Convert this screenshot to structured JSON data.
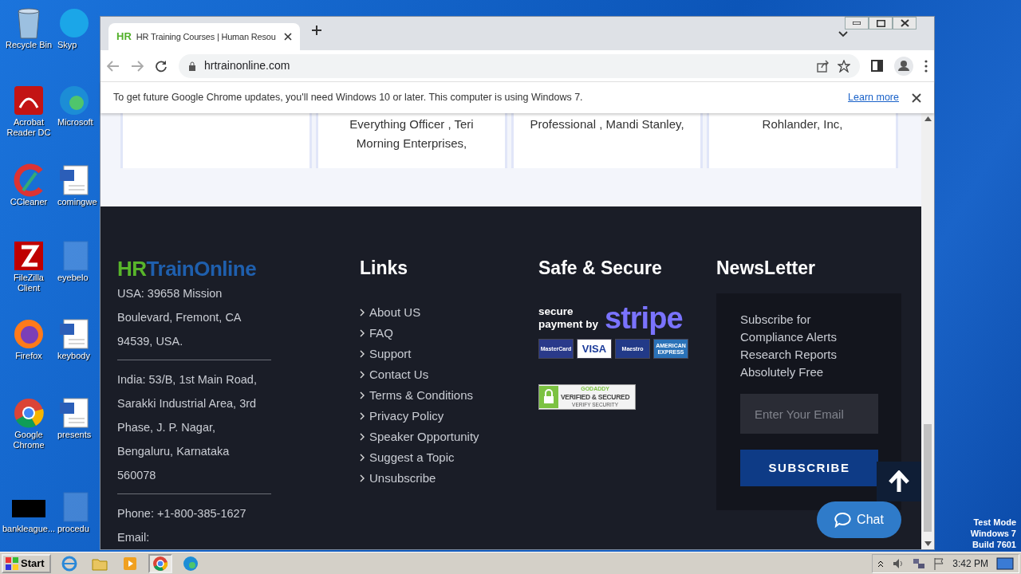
{
  "desktop": {
    "icons": [
      {
        "label": "Recycle Bin",
        "kind": "trash"
      },
      {
        "label": "Skyp",
        "kind": "skype"
      },
      {
        "label": "Acrobat Reader DC",
        "kind": "acrobat"
      },
      {
        "label": "Microsoft",
        "kind": "edge"
      },
      {
        "label": "CCleaner",
        "kind": "ccleaner"
      },
      {
        "label": "comingwe",
        "kind": "word"
      },
      {
        "label": "FileZilla Client",
        "kind": "filezilla"
      },
      {
        "label": "eyebelo",
        "kind": "word-blank"
      },
      {
        "label": "Firefox",
        "kind": "firefox"
      },
      {
        "label": "keybody",
        "kind": "word"
      },
      {
        "label": "Google Chrome",
        "kind": "chrome"
      },
      {
        "label": "presents",
        "kind": "word"
      },
      {
        "label": "bankleague...",
        "kind": "black"
      },
      {
        "label": "procedu",
        "kind": "word-blank"
      }
    ],
    "os_info": [
      "Test Mode",
      "Windows 7",
      "Build 7601"
    ]
  },
  "browser": {
    "tab": {
      "favicon": "HR",
      "title": "HR Training Courses | Human Resou"
    },
    "url": "hrtrainonline.com",
    "infobar": {
      "message": "To get future Google Chrome updates, you'll need Windows 10 or later. This computer is using Windows 7.",
      "link": "Learn more"
    }
  },
  "page": {
    "testimonial_cards": [
      {
        "kind": "blank"
      },
      {
        "kind": "quote",
        "text": "Everything Officer , Teri Morning Enterprises,"
      },
      {
        "kind": "quote",
        "text": "Professional , Mandi Stanley,"
      },
      {
        "kind": "quote",
        "text": "Rohlander, Inc,"
      }
    ],
    "footer": {
      "logo": {
        "part1": "HR",
        "part2": "TrainOnline"
      },
      "addresses": [
        "USA: 39658 Mission Boulevard, Fremont, CA 94539, USA.",
        "India: 53/B, 1st Main Road, Sarakki Industrial Area, 3rd Phase, J. P. Nagar, Bengaluru, Karnataka 560078"
      ],
      "phone": "Phone: +1-800-385-1627",
      "email_label": "Email:",
      "links": {
        "heading": "Links",
        "items": [
          "About US",
          "FAQ",
          "Support",
          "Contact Us",
          "Terms & Conditions",
          "Privacy Policy",
          "Speaker Opportunity",
          "Suggest a Topic",
          "Unsubscribe"
        ]
      },
      "secure": {
        "heading": "Safe & Secure",
        "stripe_caption": [
          "secure",
          "payment by"
        ],
        "stripe_brand": "stripe",
        "cards": [
          {
            "kind": "mastercard",
            "label": "MasterCard"
          },
          {
            "kind": "visa",
            "label": "VISA"
          },
          {
            "kind": "maestro",
            "label": "Maestro"
          },
          {
            "kind": "amex",
            "label": "AMERICAN EXPRESS"
          }
        ],
        "seal": {
          "brand": "GODADDY",
          "title": "VERIFIED & SECURED",
          "subtitle": "VERIFY SECURITY"
        }
      },
      "newsletter": {
        "heading": "NewsLetter",
        "lines": [
          "Subscribe for",
          "Compliance Alerts",
          "Research Reports",
          "Absolutely Free"
        ],
        "placeholder": "Enter Your Email",
        "button": "SUBSCRIBE"
      }
    },
    "chat": "Chat"
  },
  "taskbar": {
    "start": "Start",
    "apps": [
      {
        "kind": "ie",
        "selected": false
      },
      {
        "kind": "folder",
        "selected": false
      },
      {
        "kind": "media",
        "selected": false
      },
      {
        "kind": "chrome",
        "selected": true
      },
      {
        "kind": "edge",
        "selected": false
      }
    ],
    "clock": "3:42 PM"
  }
}
